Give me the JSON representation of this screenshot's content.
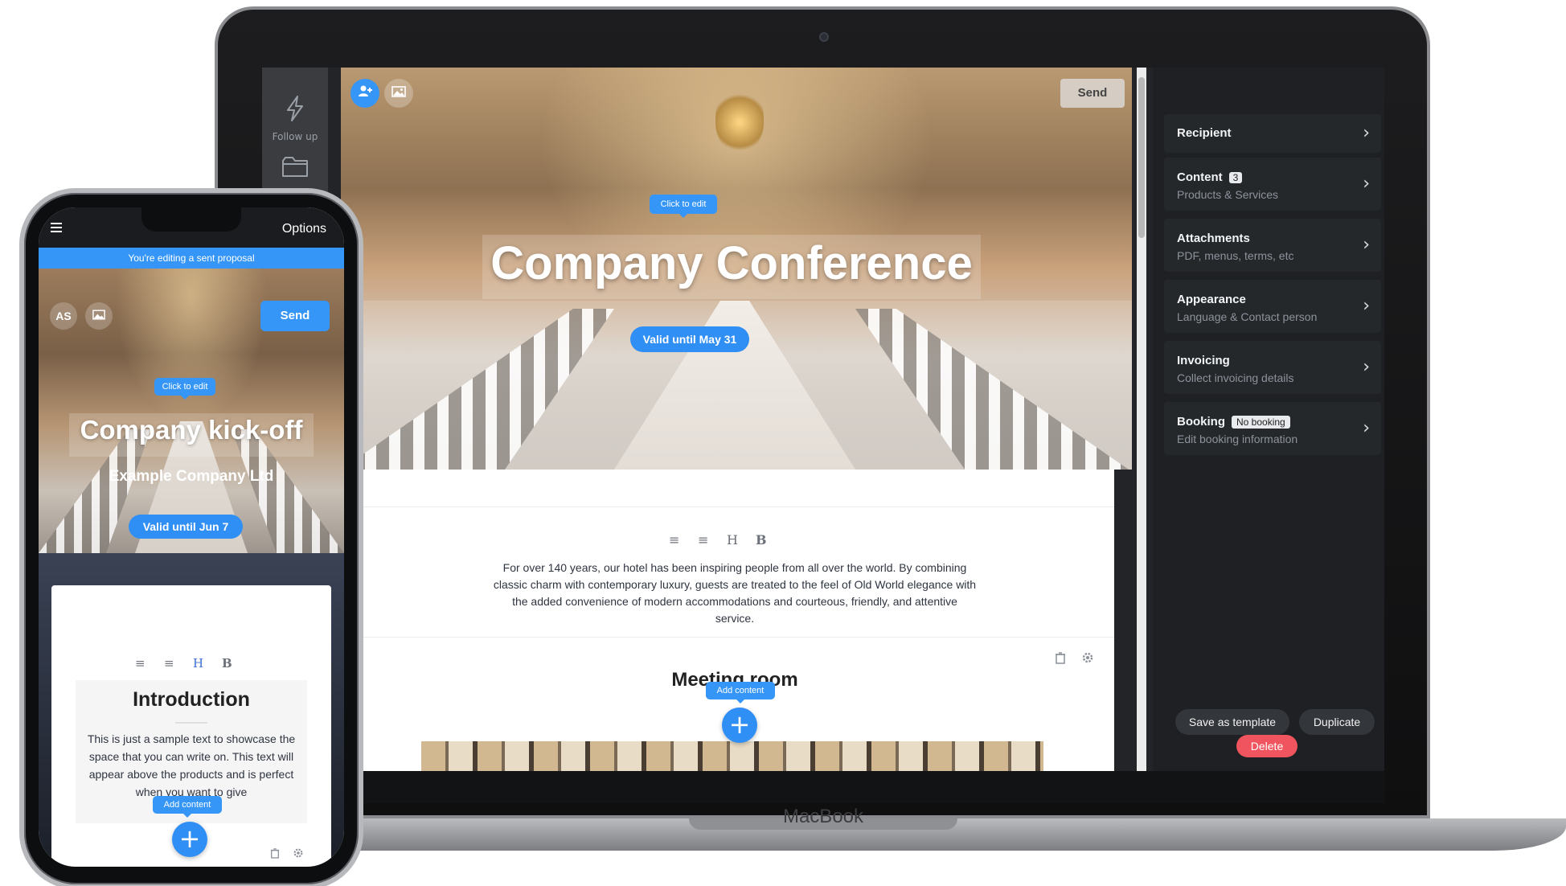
{
  "laptop": {
    "brand": "MacBook",
    "rail": {
      "follow_up_label": "Follow up"
    },
    "hero": {
      "send_label": "Send",
      "click_to_edit": "Click to edit",
      "title": "Company Conference",
      "valid_until": "Valid until May 31"
    },
    "content": {
      "format_buttons": [
        "≡",
        "≡",
        "H",
        "B"
      ],
      "body_text": "For over 140 years, our hotel has been inspiring people from all over the world. By combining classic charm with contemporary luxury, guests are treated to the feel of Old World elegance with the added convenience of modern accommodations and courteous, friendly, and attentive service.",
      "section_title": "Meeting room",
      "add_content": "Add content",
      "add_symbol": "+"
    },
    "panel": {
      "items": [
        {
          "title": "Recipient",
          "subtitle": ""
        },
        {
          "title": "Content",
          "badge": "3",
          "subtitle": "Products & Services"
        },
        {
          "title": "Attachments",
          "subtitle": "PDF, menus, terms, etc"
        },
        {
          "title": "Appearance",
          "subtitle": "Language & Contact person"
        },
        {
          "title": "Invoicing",
          "subtitle": "Collect invoicing details"
        },
        {
          "title": "Booking",
          "badge": "No booking",
          "subtitle": "Edit booking information"
        }
      ],
      "save_template": "Save as template",
      "duplicate": "Duplicate",
      "delete": "Delete"
    }
  },
  "phone": {
    "options": "Options",
    "banner": "You're editing a sent proposal",
    "avatar_initials": "AS",
    "send_label": "Send",
    "click_to_edit": "Click to edit",
    "title": "Company kick-off",
    "company": "Example Company Ltd",
    "valid_until": "Valid until Jun 7",
    "format_buttons": [
      "≡",
      "≡",
      "H",
      "B"
    ],
    "intro_title": "Introduction",
    "intro_text": "This is just a sample text to showcase the space that you can write on. This text will appear above the products and is perfect when you want to give",
    "add_content": "Add content",
    "add_symbol": "+"
  },
  "colors": {
    "accent_blue": "#2f8ff5",
    "delete_red": "#f0555f",
    "panel_dark": "#1e2023"
  }
}
